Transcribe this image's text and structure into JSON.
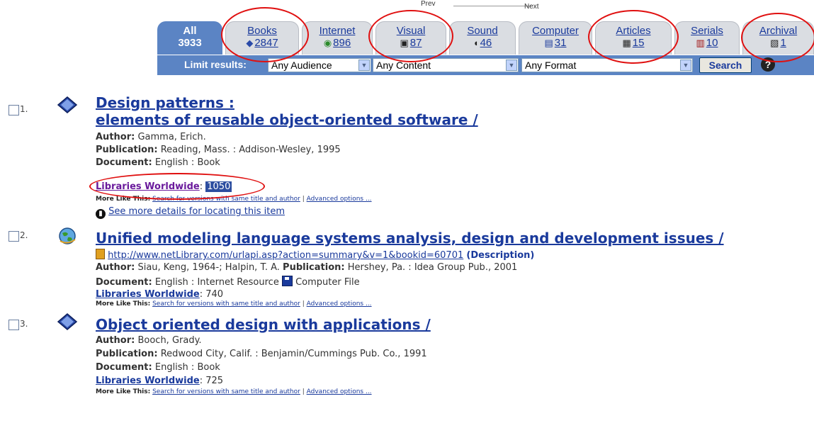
{
  "pager": {
    "prev": "Prev",
    "next": "Next"
  },
  "tabs": [
    {
      "label": "All",
      "count": "3933",
      "icon": "all-icon",
      "active": true
    },
    {
      "label": "Books",
      "count": "2847",
      "icon": "book-icon"
    },
    {
      "label": "Internet",
      "count": "896",
      "icon": "globe-icon"
    },
    {
      "label": "Visual",
      "count": "87",
      "icon": "camera-icon"
    },
    {
      "label": "Sound",
      "count": "46",
      "icon": "speaker-icon"
    },
    {
      "label": "Computer",
      "count": "31",
      "icon": "floppy-disk-icon"
    },
    {
      "label": "Articles",
      "count": "15",
      "icon": "document-icon"
    },
    {
      "label": "Serials",
      "count": "10",
      "icon": "serials-icon"
    },
    {
      "label": "Archival",
      "count": "1",
      "icon": "archive-icon"
    }
  ],
  "limit": {
    "label": "Limit results:",
    "audience": "Any Audience",
    "content": "Any Content",
    "format": "Any Format",
    "search_label": "Search",
    "help": "?"
  },
  "results": [
    {
      "num": "1.",
      "icon": "book-icon",
      "title1": "Design patterns :",
      "title2": "elements of reusable object-oriented software /",
      "author_label": "Author:",
      "author": "Gamma, Erich.",
      "pub_label": "Publication:",
      "pub": "Reading, Mass. : Addison-Wesley, 1995",
      "doc_label": "Document:",
      "doc": "English : Book",
      "lw_label": "Libraries Worldwide",
      "lw_count": "1050",
      "more_label": "More Like This:",
      "more_link": "Search for versions with same title and author",
      "sep": "|",
      "adv": "Advanced options ...",
      "details": "See more details for locating this item"
    },
    {
      "num": "2.",
      "icon": "globe-icon",
      "title": "Unified modeling language systems analysis, design and development issues /",
      "url": "http://www.netLibrary.com/urlapi.asp?action=summary&v=1&bookid=60701",
      "desc": "(Description)",
      "author_label": "Author:",
      "author": "Siau, Keng, 1964-; Halpin, T. A.",
      "pub_label": "Publication:",
      "pub": "Hershey, Pa. : Idea Group Pub., 2001",
      "doc_label": "Document:",
      "doc": "English : Internet Resource",
      "doc2": "Computer File",
      "lw_label": "Libraries Worldwide",
      "lw_count": "740",
      "more_label": "More Like This:",
      "more_link": "Search for versions with same title and author",
      "sep": "|",
      "adv": "Advanced options ..."
    },
    {
      "num": "3.",
      "icon": "book-icon",
      "title": "Object oriented design with applications /",
      "author_label": "Author:",
      "author": "Booch, Grady.",
      "pub_label": "Publication:",
      "pub": "Redwood City, Calif. : Benjamin/Cummings Pub. Co., 1991",
      "doc_label": "Document:",
      "doc": "English : Book",
      "lw_label": "Libraries Worldwide",
      "lw_count": "725",
      "more_label": "More Like This:",
      "more_link": "Search for versions with same title and author",
      "sep": "|",
      "adv": "Advanced options ..."
    }
  ],
  "colors": {
    "accent": "#5b84c4",
    "link": "#1a3a9c",
    "annotation": "#e01010"
  }
}
